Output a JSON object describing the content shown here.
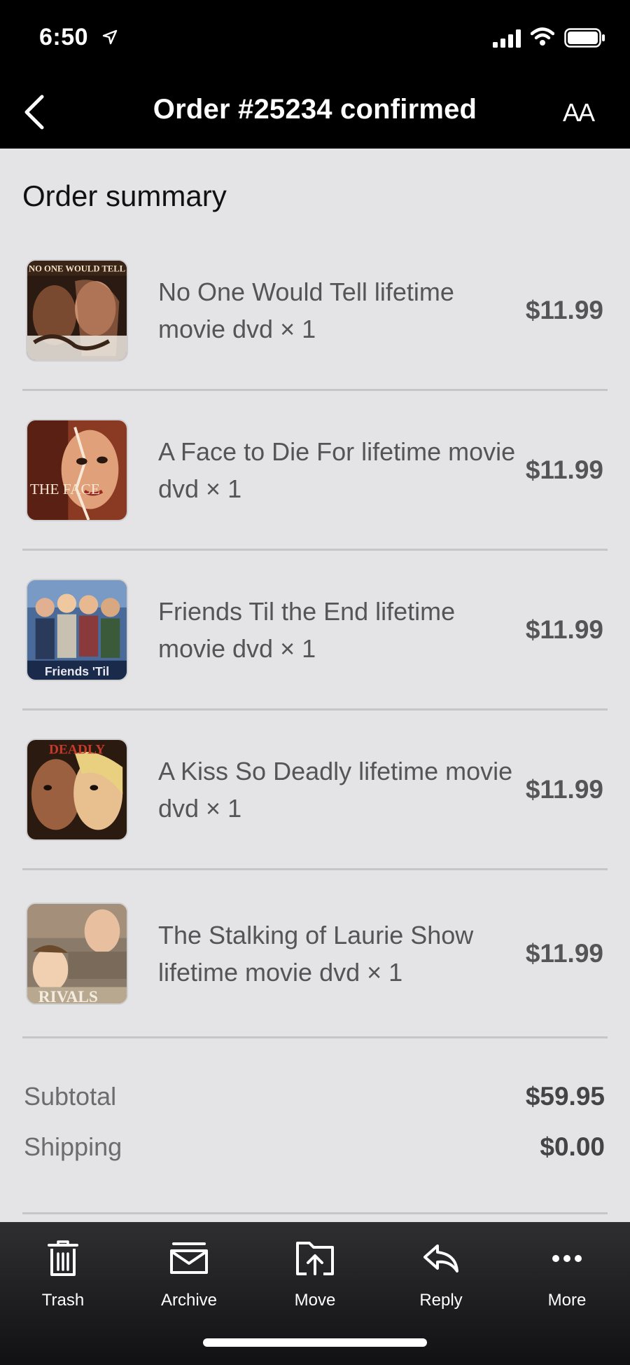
{
  "status_bar": {
    "time": "6:50"
  },
  "nav": {
    "title": "Order #25234 confirmed",
    "text_size_label": "AA"
  },
  "summary": {
    "title": "Order summary",
    "items": [
      {
        "name": "No One Would Tell lifetime movie dvd × 1",
        "price": "$11.99"
      },
      {
        "name": "A Face to Die For lifetime movie dvd × 1",
        "price": "$11.99"
      },
      {
        "name": "Friends Til the End lifetime movie dvd × 1",
        "price": "$11.99"
      },
      {
        "name": "A Kiss So Deadly lifetime movie dvd × 1",
        "price": "$11.99"
      },
      {
        "name": "The Stalking of Laurie Show lifetime movie dvd × 1",
        "price": "$11.99"
      }
    ],
    "subtotal_label": "Subtotal",
    "subtotal_value": "$59.95",
    "shipping_label": "Shipping",
    "shipping_value": "$0.00"
  },
  "toolbar": {
    "trash": "Trash",
    "archive": "Archive",
    "move": "Move",
    "reply": "Reply",
    "more": "More"
  },
  "thumb_text": {
    "item0": "NO ONE WOULD TELL",
    "item1": "THE FACE",
    "item2": "Friends 'Til",
    "item3": "DEADLY",
    "item4": "RIVALS"
  }
}
